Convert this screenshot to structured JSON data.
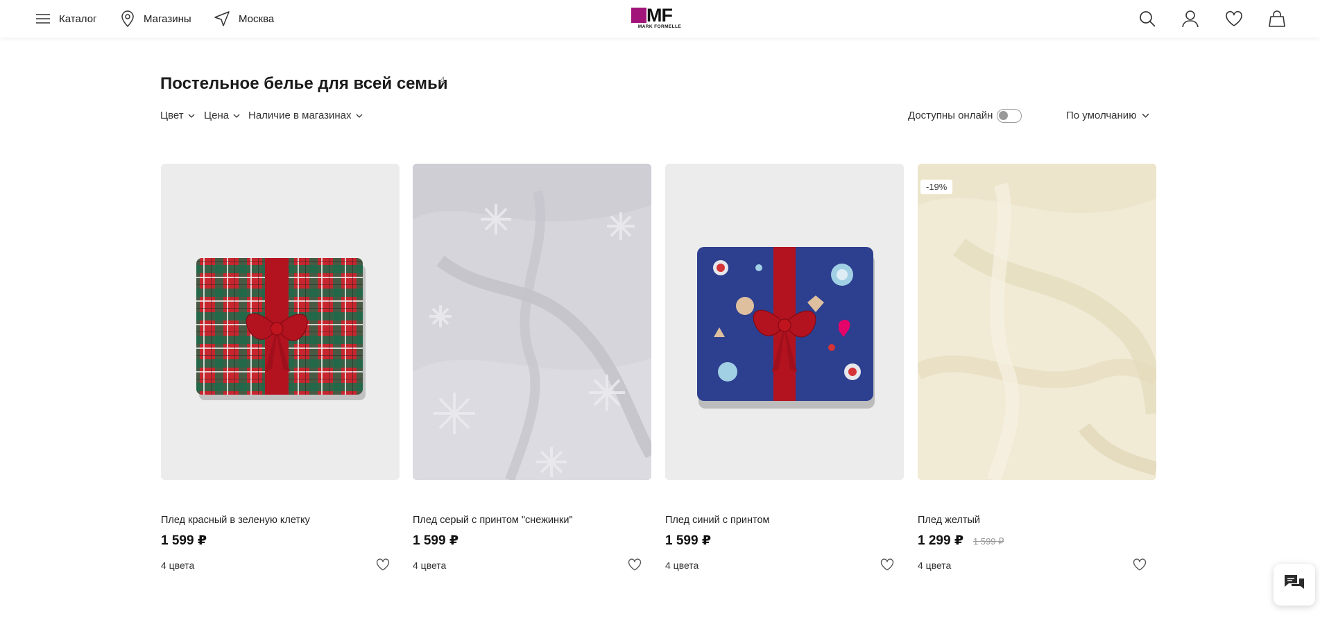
{
  "header": {
    "catalog_label": "Каталог",
    "stores_label": "Магазины",
    "city_label": "Москва",
    "logo_letters": "MF",
    "logo_subtitle": "MARK FORMELLE",
    "brand_color": "#a3147a"
  },
  "page": {
    "title": "Постельное белье для всей семьи",
    "count": "4"
  },
  "filters": {
    "items": [
      {
        "label": "Цвет"
      },
      {
        "label": "Цена"
      },
      {
        "label": "Наличие в магазинах"
      }
    ],
    "online_toggle_label": "Доступны онлайн",
    "online_toggle_on": false,
    "sort_label": "По умолчанию"
  },
  "products": [
    {
      "name": "Плед красный в зеленую клетку",
      "price": "1 599 ₽",
      "old_price": "",
      "badge": "",
      "colors": "4 цвета",
      "image": "red-green-plaid-blanket-with-red-bow"
    },
    {
      "name": "Плед серый с принтом \"снежинки\"",
      "price": "1 599 ₽",
      "old_price": "",
      "badge": "",
      "colors": "4 цвета",
      "image": "grey-fleece-with-snowflakes"
    },
    {
      "name": "Плед синий с принтом",
      "price": "1 599 ₽",
      "old_price": "",
      "badge": "",
      "colors": "4 цвета",
      "image": "blue-candy-print-blanket-with-red-bow"
    },
    {
      "name": "Плед желтый",
      "price": "1 299 ₽",
      "old_price": "1 599 ₽",
      "badge": "-19%",
      "colors": "4 цвета",
      "image": "cream-fleece"
    }
  ],
  "icons": [
    "menu-icon",
    "location-pin-icon",
    "navigation-arrow-icon",
    "search-icon",
    "user-icon",
    "heart-icon",
    "bag-icon",
    "chat-icon"
  ]
}
